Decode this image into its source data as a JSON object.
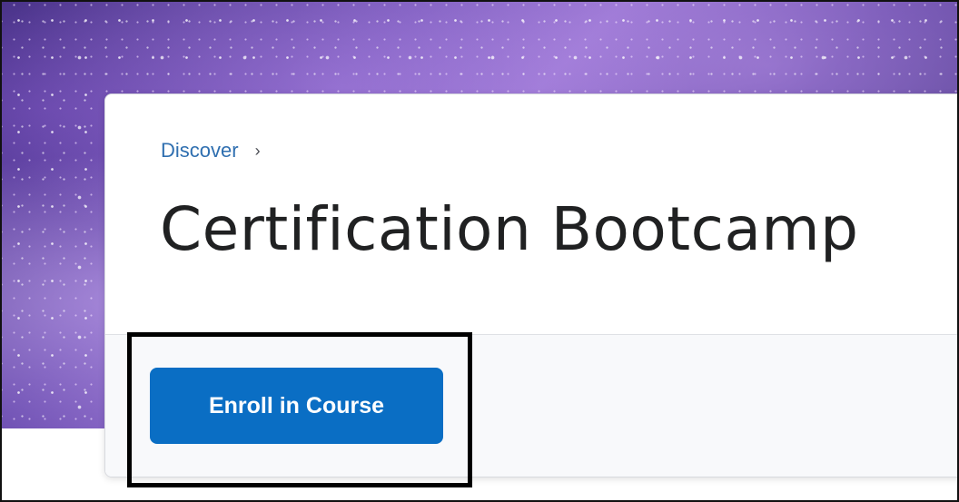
{
  "breadcrumb": {
    "link_label": "Discover",
    "separator": "›"
  },
  "page": {
    "title": "Certification Bootcamp"
  },
  "actions": {
    "enroll_label": "Enroll in Course"
  },
  "colors": {
    "accent": "#0a6ec4",
    "link": "#2f6fb0",
    "title_text": "#202122",
    "highlight_border": "#000000"
  },
  "icons": {
    "breadcrumb_separator": "chevron-right-icon"
  }
}
